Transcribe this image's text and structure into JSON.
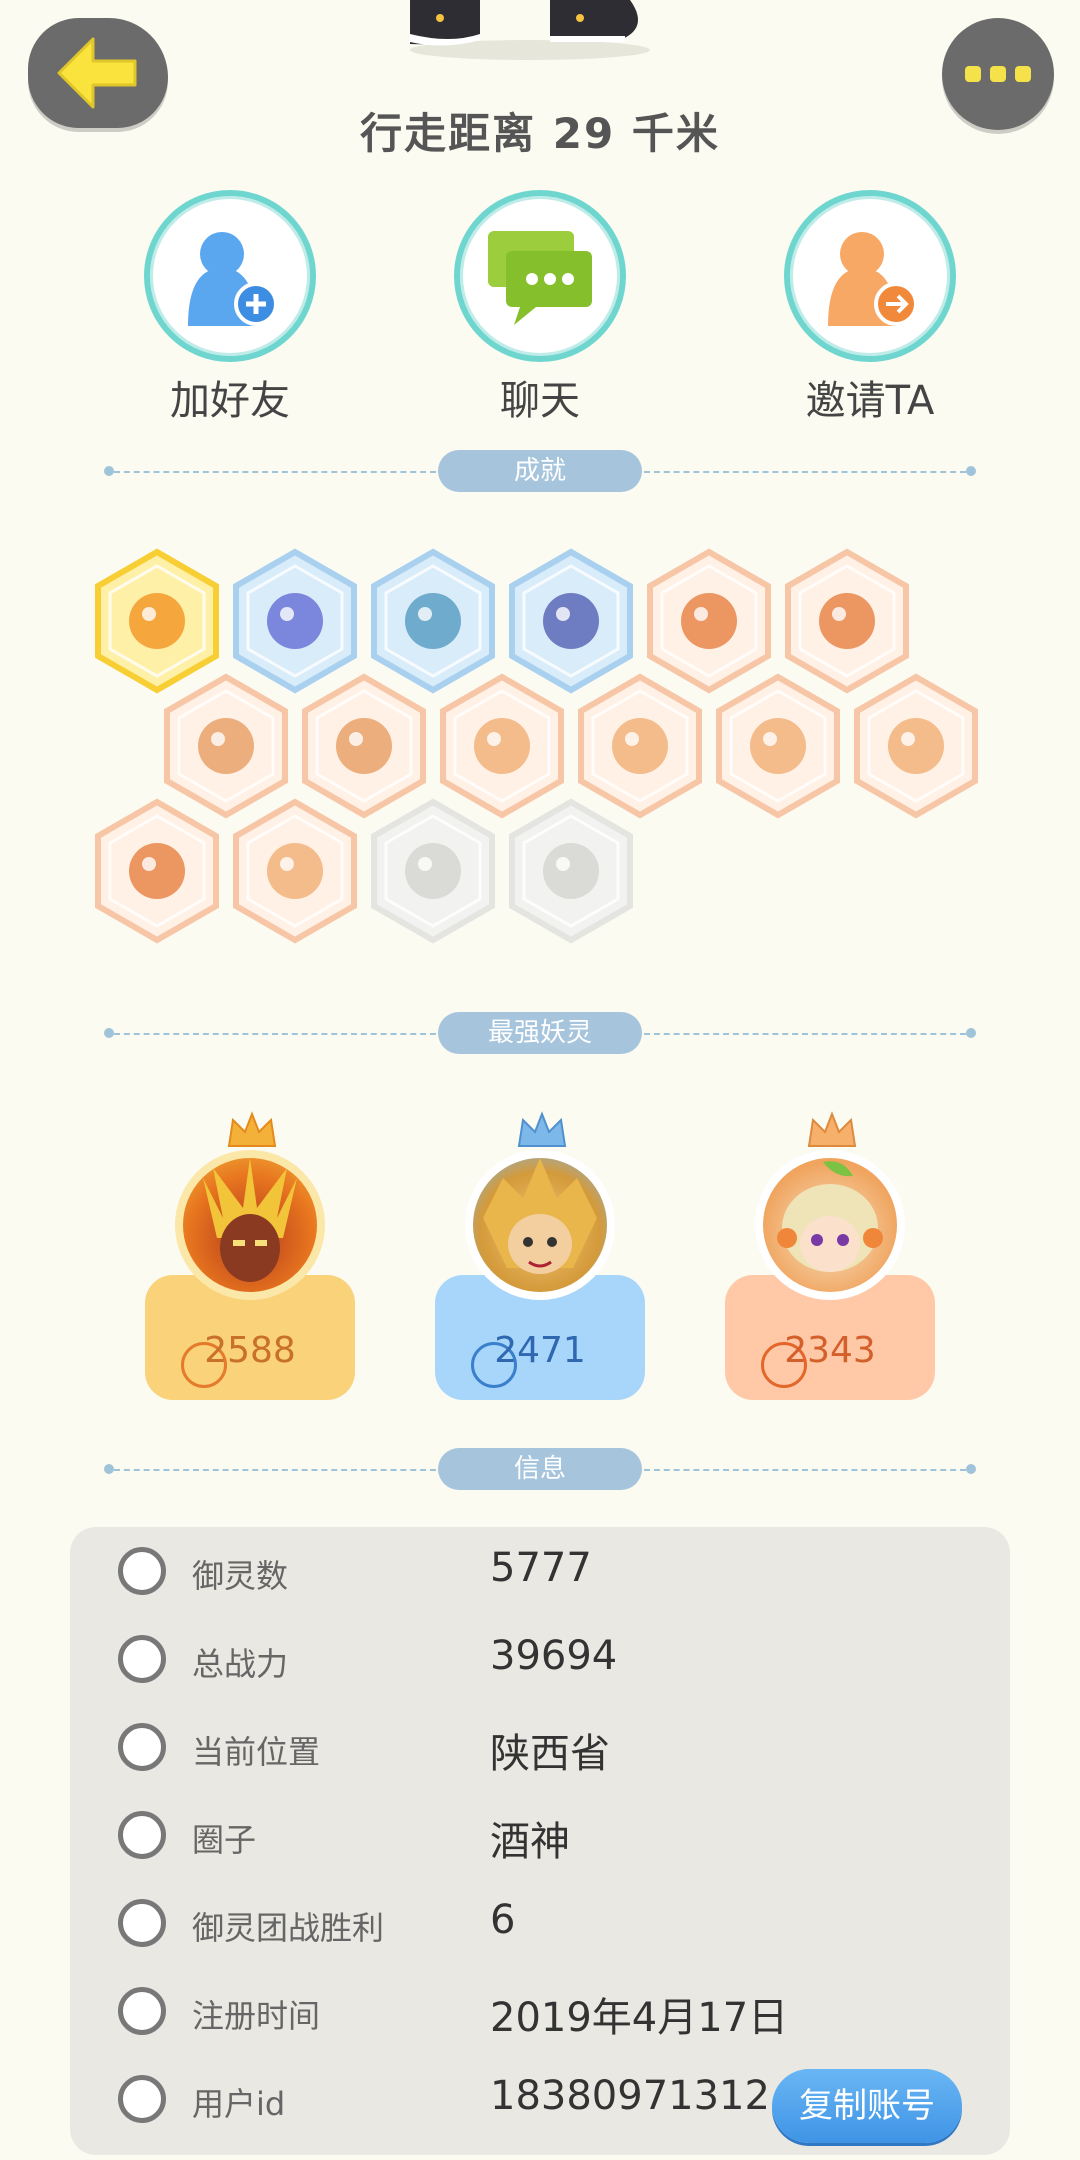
{
  "header": {
    "distance_text": "行走距离 29 千米"
  },
  "actions": [
    {
      "label": "加好友",
      "icon": "add-friend-icon"
    },
    {
      "label": "聊天",
      "icon": "chat-icon"
    },
    {
      "label": "邀请TA",
      "icon": "invite-icon"
    }
  ],
  "sections": {
    "achievements": "成就",
    "strongest": "最强妖灵",
    "info": "信息"
  },
  "achievement_count": 16,
  "top_spirits": [
    {
      "score": "2588",
      "theme": "gold"
    },
    {
      "score": "2471",
      "theme": "blue"
    },
    {
      "score": "2343",
      "theme": "orange"
    }
  ],
  "info": {
    "rows": [
      {
        "key": "御灵数",
        "value": "5777",
        "icon": "spirit-count-icon"
      },
      {
        "key": "总战力",
        "value": "39694",
        "icon": "power-icon"
      },
      {
        "key": "当前位置",
        "value": "陕西省",
        "icon": "location-icon"
      },
      {
        "key": "圈子",
        "value": "酒神",
        "icon": "circle-icon"
      },
      {
        "key": "御灵团战胜利",
        "value": "6",
        "icon": "battle-win-icon"
      },
      {
        "key": "注册时间",
        "value": "2019年4月17日",
        "icon": "clock-icon"
      },
      {
        "key": "用户id",
        "value": "18380971312",
        "icon": "user-id-icon"
      }
    ],
    "copy_button": "复制账号"
  },
  "colors": {
    "background": "#fbfbf2",
    "accent_blue": "#4a9fe9",
    "gold": "#f9d27a",
    "blue_card": "#a8d6fb",
    "orange_card": "#ffc9a8"
  }
}
